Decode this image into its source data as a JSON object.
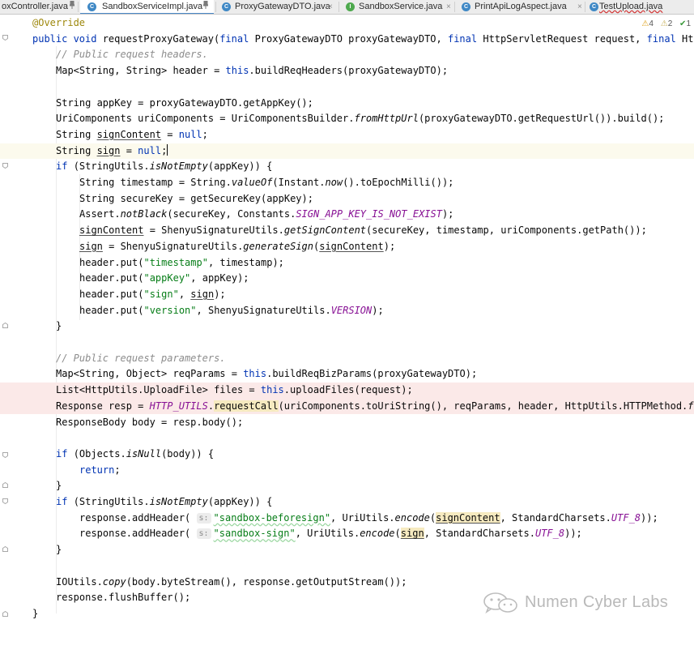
{
  "tabs": [
    {
      "label": "oxController.java",
      "icon": "",
      "icon_color": "",
      "active": false,
      "pinned": true,
      "extra": ""
    },
    {
      "label": "SandboxServiceImpl.java",
      "icon": "C",
      "icon_color": "#3f88c5",
      "active": true,
      "pinned": true,
      "extra": ""
    },
    {
      "label": "ProxyGatewayDTO.java",
      "icon": "C",
      "icon_color": "#3f88c5",
      "active": false,
      "pinned": false,
      "extra": "×"
    },
    {
      "label": "SandboxService.java",
      "icon": "I",
      "icon_color": "#4da94d",
      "active": false,
      "pinned": false,
      "extra": "×"
    },
    {
      "label": "PrintApiLogAspect.java",
      "icon": "C",
      "icon_color": "#3f88c5",
      "active": false,
      "pinned": false,
      "extra": "×"
    },
    {
      "label": "TestUpload.java",
      "icon": "C",
      "icon_color": "#3f88c5",
      "active": false,
      "pinned": false,
      "extra": ""
    }
  ],
  "inspections": {
    "warnings": "4",
    "weak_warnings": "2",
    "ok": "1"
  },
  "code": {
    "l01": {
      "ann": "@Override"
    },
    "l02": {
      "kw1": "public void ",
      "a": "requestProxyGateway(",
      "kw2": "final ",
      "b": "ProxyGatewayDTO proxyGatewayDTO, ",
      "kw3": "final ",
      "c": "HttpServletRequest request, ",
      "kw4": "final ",
      "d": "Htt"
    },
    "l03": {
      "cm": "// Public request headers."
    },
    "l04": {
      "a": "Map<String, String> header = ",
      "kw": "this",
      "b": ".buildReqHeaders(proxyGatewayDTO);"
    },
    "l06": {
      "a": "String appKey = proxyGatewayDTO.getAppKey();"
    },
    "l07": {
      "a": "UriComponents uriComponents = UriComponentsBuilder.",
      "sm": "fromHttpUrl",
      "b": "(proxyGatewayDTO.getRequestUrl()).build();"
    },
    "l08": {
      "a": "String ",
      "ul": "signContent",
      "b": " = ",
      "kw": "null",
      "c": ";"
    },
    "l09": {
      "a": "String ",
      "ul": "sign",
      "b": " = ",
      "kw": "null",
      "c": ";"
    },
    "l10": {
      "kw": "if ",
      "a": "(StringUtils.",
      "sm": "isNotEmpty",
      "b": "(appKey)) {"
    },
    "l11": {
      "a": "String timestamp = String.",
      "sm": "valueOf",
      "b": "(Instant.",
      "sm2": "now",
      "c": "().toEpochMilli());"
    },
    "l12": {
      "a": "String secureKey = getSecureKey(appKey);"
    },
    "l13": {
      "a": "Assert.",
      "sm": "notBlack",
      "b": "(secureKey, Constants.",
      "cst": "SIGN_APP_KEY_IS_NOT_EXIST",
      "c": ");"
    },
    "l14": {
      "ul": "signContent",
      "a": " = ShenyuSignatureUtils.",
      "sm": "getSignContent",
      "b": "(secureKey, timestamp, uriComponents.getPath());"
    },
    "l15": {
      "ul": "sign",
      "a": " = ShenyuSignatureUtils.",
      "sm": "generateSign",
      "b": "(",
      "ul2": "signContent",
      "c": ");"
    },
    "l16": {
      "a": "header.put(",
      "str": "\"timestamp\"",
      "b": ", timestamp);"
    },
    "l17": {
      "a": "header.put(",
      "str": "\"appKey\"",
      "b": ", appKey);"
    },
    "l18": {
      "a": "header.put(",
      "str": "\"sign\"",
      "b": ", ",
      "ul": "sign",
      "c": ");"
    },
    "l19": {
      "a": "header.put(",
      "str": "\"version\"",
      "b": ", ShenyuSignatureUtils.",
      "cst": "VERSION",
      "c": ");"
    },
    "l20": {
      "a": "}"
    },
    "l22": {
      "cm": "// Public request parameters."
    },
    "l23": {
      "a": "Map<String, Object> reqParams = ",
      "kw": "this",
      "b": ".buildReqBizParams(proxyGatewayDTO);"
    },
    "l24": {
      "a": "List<HttpUtils.UploadFile> files = ",
      "kw": "this",
      "b": ".uploadFiles(request);"
    },
    "l25": {
      "a": "Response resp = ",
      "cst": "HTTP_UTILS",
      "b": ".",
      "hl": "requestCall",
      "c": "(uriComponents.toUriString(), reqParams, header, HttpUtils.HTTPMethod.",
      "sm": "fr"
    },
    "l26": {
      "a": "ResponseBody body = resp.body();"
    },
    "l28": {
      "kw": "if ",
      "a": "(Objects.",
      "sm": "isNull",
      "b": "(body)) {"
    },
    "l29": {
      "kw": "return",
      "a": ";"
    },
    "l30": {
      "a": "}"
    },
    "l31": {
      "kw": "if ",
      "a": "(StringUtils.",
      "sm": "isNotEmpty",
      "b": "(appKey)) {"
    },
    "l32": {
      "a": "response.addHeader( ",
      "hint": "s:",
      "str": "\"sandbox-beforesign\"",
      "b": ", UriUtils.",
      "sm": "encode",
      "c": "(",
      "hl": "signContent",
      "d": ", StandardCharsets.",
      "cst": "UTF_8",
      "e": "));"
    },
    "l33": {
      "a": "response.addHeader( ",
      "hint": "s:",
      "str": "\"sandbox-sign\"",
      "b": ", UriUtils.",
      "sm": "encode",
      "c": "(",
      "hl": "sign",
      "d": ", StandardCharsets.",
      "cst": "UTF_8",
      "e": "));"
    },
    "l34": {
      "a": "}"
    },
    "l36": {
      "a": "IOUtils.",
      "sm": "copy",
      "b": "(body.byteStream(), response.getOutputStream());"
    },
    "l37": {
      "a": "response.flushBuffer();"
    },
    "l38": {
      "a": "}"
    }
  },
  "watermark": {
    "text": "Numen Cyber Labs"
  }
}
